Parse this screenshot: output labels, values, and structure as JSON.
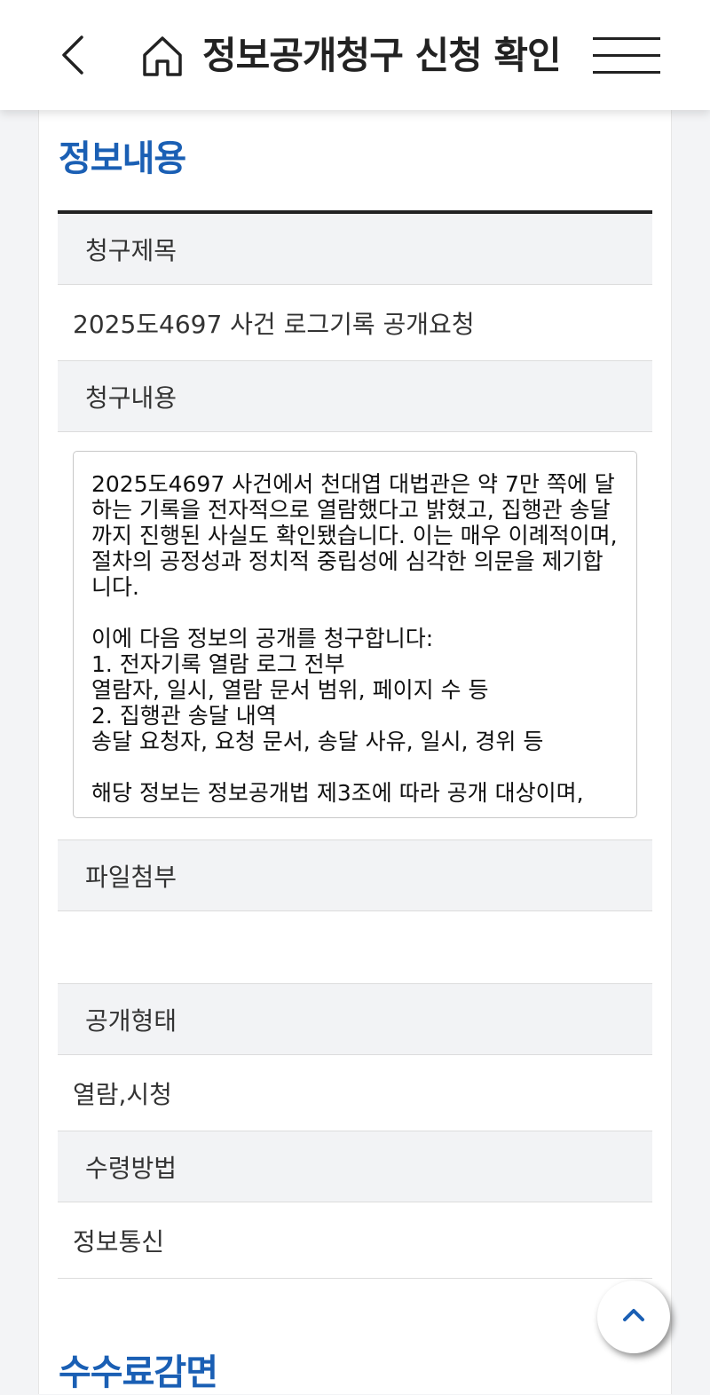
{
  "header": {
    "title": "정보공개청구 신청 확인",
    "back_icon": "chevron-left-icon",
    "home_icon": "home-icon",
    "menu_icon": "hamburger-menu-icon"
  },
  "sections": {
    "info_title": "정보내용",
    "fee_title": "수수료감면"
  },
  "fields": {
    "request_title_label": "청구제목",
    "request_title_value": "2025도4697 사건 로그기록 공개요청",
    "request_content_label": "청구내용",
    "request_content_value": "2025도4697 사건에서 천대엽 대법관은 약 7만 쪽에 달하는 기록을 전자적으로 열람했다고 밝혔고, 집행관 송달까지 진행된 사실도 확인됐습니다. 이는 매우 이례적이며, 절차의 공정성과 정치적 중립성에 심각한 의문을 제기합니다.\n\n이에 다음 정보의 공개를 청구합니다:\n1. 전자기록 열람 로그 전부\n열람자, 일시, 열람 문서 범위, 페이지 수 등\n2. 집행관 송달 내역\n송달 요청자, 요청 문서, 송달 사유, 일시, 경위 등\n\n해당 정보는 정보공개법 제3조에 따라 공개 대상이며,",
    "attachment_label": "파일첨부",
    "attachment_value": "",
    "disclosure_type_label": "공개형태",
    "disclosure_type_value": "열람,시청",
    "receive_method_label": "수령방법",
    "receive_method_value": "정보통신"
  },
  "scroll_top_icon": "chevron-up-icon",
  "colors": {
    "accent": "#1a5fb4",
    "table_head_bg": "#f2f3f5",
    "page_bg": "#f3f4f6"
  }
}
